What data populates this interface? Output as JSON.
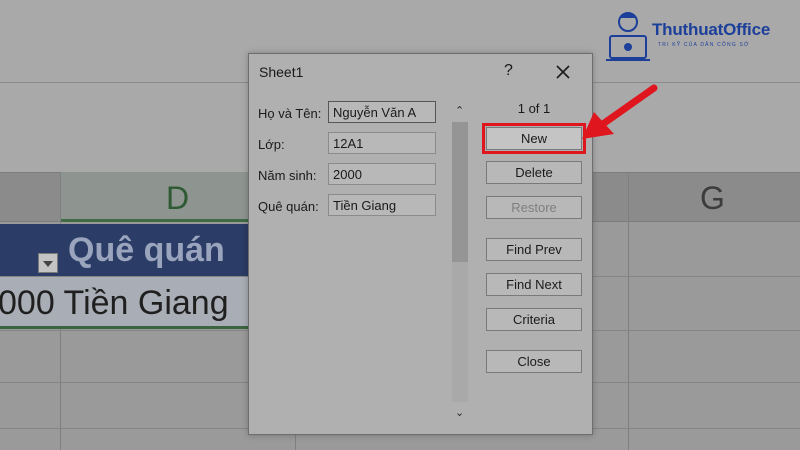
{
  "background": {
    "column_letters": [
      "D",
      "G"
    ],
    "table_header": "Quê quán",
    "table_row": "000 Tiền Giang"
  },
  "logo": {
    "brand": "ThuthuatOffice",
    "tagline": "TRI KỸ CỦA DÂN CÔNG SỞ"
  },
  "dialog": {
    "title": "Sheet1",
    "help": "?",
    "record_counter": "1 of 1",
    "fields": [
      {
        "label": "Họ và Tên:",
        "value": "Nguyễn Văn A"
      },
      {
        "label": "Lớp:",
        "value": "12A1"
      },
      {
        "label": "Năm sinh:",
        "value": "2000"
      },
      {
        "label": "Quê quán:",
        "value": "Tiền Giang"
      }
    ],
    "buttons": {
      "new": "New",
      "delete": "Delete",
      "restore": "Restore",
      "find_prev": "Find Prev",
      "find_next": "Find Next",
      "criteria": "Criteria",
      "close": "Close"
    }
  },
  "colors": {
    "highlight": "#e0161e",
    "table_header_bg": "#2b3c66",
    "brand_blue": "#1c3f9a"
  },
  "icons": [
    "close-icon",
    "filter-dropdown-icon",
    "scroll-up-icon",
    "scroll-down-icon",
    "red-arrow-icon",
    "office-worker-logo-icon"
  ]
}
